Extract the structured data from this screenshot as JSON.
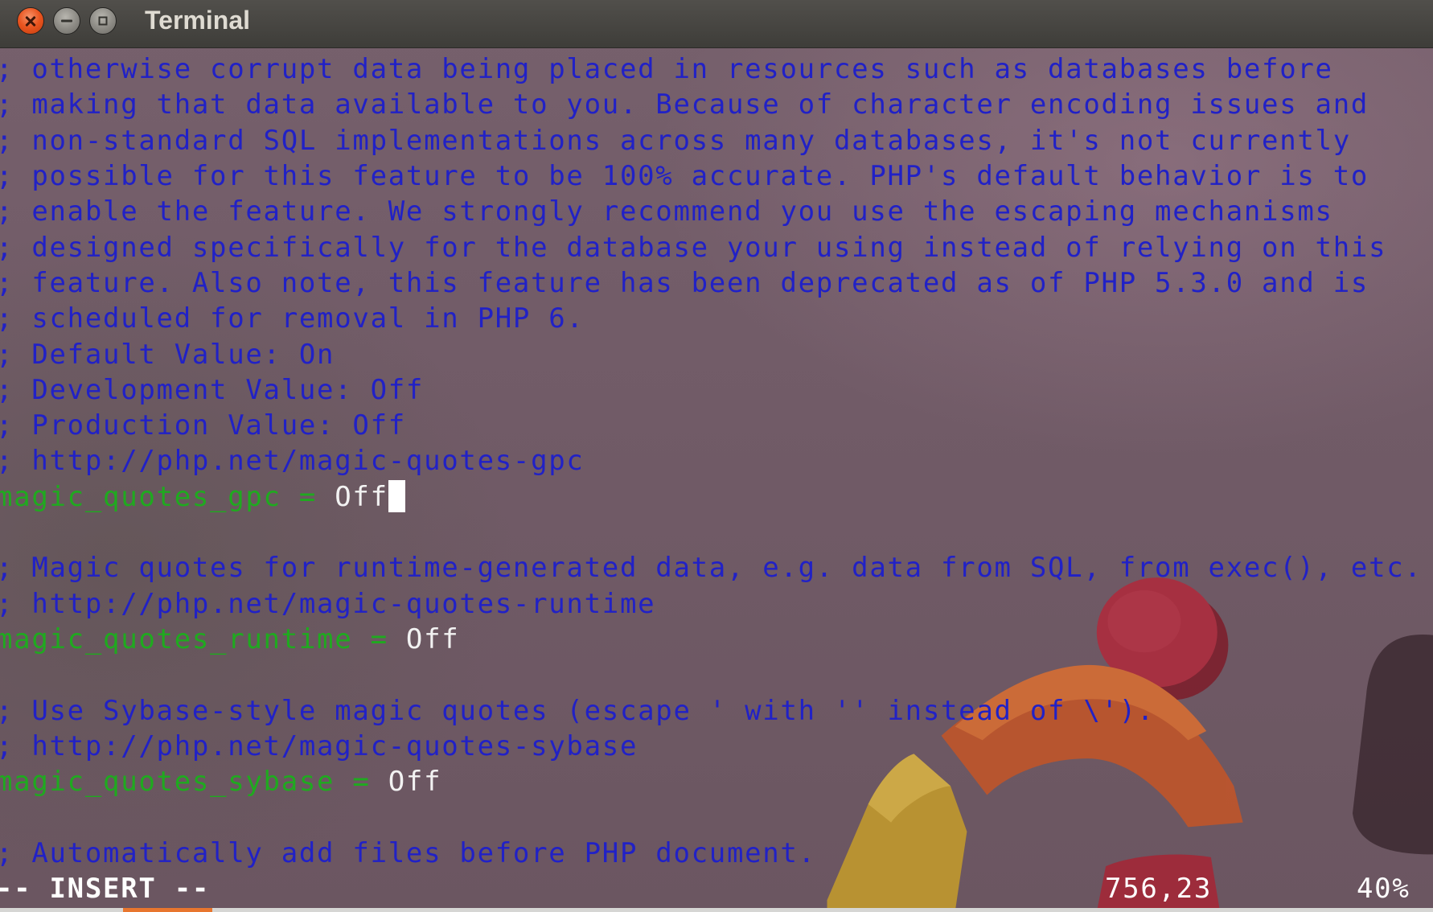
{
  "window": {
    "title": "Terminal",
    "controls": {
      "close": {
        "icon": "close-icon"
      },
      "minimize": {
        "icon": "minimize-icon"
      },
      "maximize": {
        "icon": "maximize-icon"
      }
    }
  },
  "editor": {
    "lines": [
      {
        "text": "; otherwise corrupt data being placed in resources such as databases before"
      },
      {
        "text": "; making that data available to you. Because of character encoding issues and"
      },
      {
        "text": "; non-standard SQL implementations across many databases, it's not currently"
      },
      {
        "text": "; possible for this feature to be 100% accurate. PHP's default behavior is to"
      },
      {
        "text": "; enable the feature. We strongly recommend you use the escaping mechanisms"
      },
      {
        "text": "; designed specifically for the database your using instead of relying on this"
      },
      {
        "text": "; feature. Also note, this feature has been deprecated as of PHP 5.3.0 and is"
      },
      {
        "text": "; scheduled for removal in PHP 6."
      },
      {
        "text": "; Default Value: On"
      },
      {
        "text": "; Development Value: Off"
      },
      {
        "text": "; Production Value: Off"
      },
      {
        "text": "; http://php.net/magic-quotes-gpc"
      },
      {
        "key": "magic_quotes_gpc",
        "operator": "=",
        "value": "Off"
      },
      {
        "text": ""
      },
      {
        "text": "; Magic quotes for runtime-generated data, e.g. data from SQL, from exec(), etc."
      },
      {
        "text": "; http://php.net/magic-quotes-runtime"
      },
      {
        "key": "magic_quotes_runtime",
        "operator": "=",
        "value": "Off"
      },
      {
        "text": ""
      },
      {
        "text": "; Use Sybase-style magic quotes (escape ' with '' instead of \\')."
      },
      {
        "text": "; http://php.net/magic-quotes-sybase"
      },
      {
        "key": "magic_quotes_sybase",
        "operator": "=",
        "value": "Off"
      },
      {
        "text": ""
      },
      {
        "text": "; Automatically add files before PHP document."
      }
    ]
  },
  "statusline": {
    "mode": "-- INSERT --",
    "position": "756,23",
    "scroll_percent": "40%"
  },
  "colors": {
    "comment_text": "#2121c6",
    "setting_key": "#1faa1f",
    "setting_value": "#f2f2f2",
    "status_text": "#ffffff",
    "cursor": "#ffffff",
    "title_text": "#dfdbd2",
    "close_button": "#e9541f",
    "terminal_background": "#6e5964"
  }
}
